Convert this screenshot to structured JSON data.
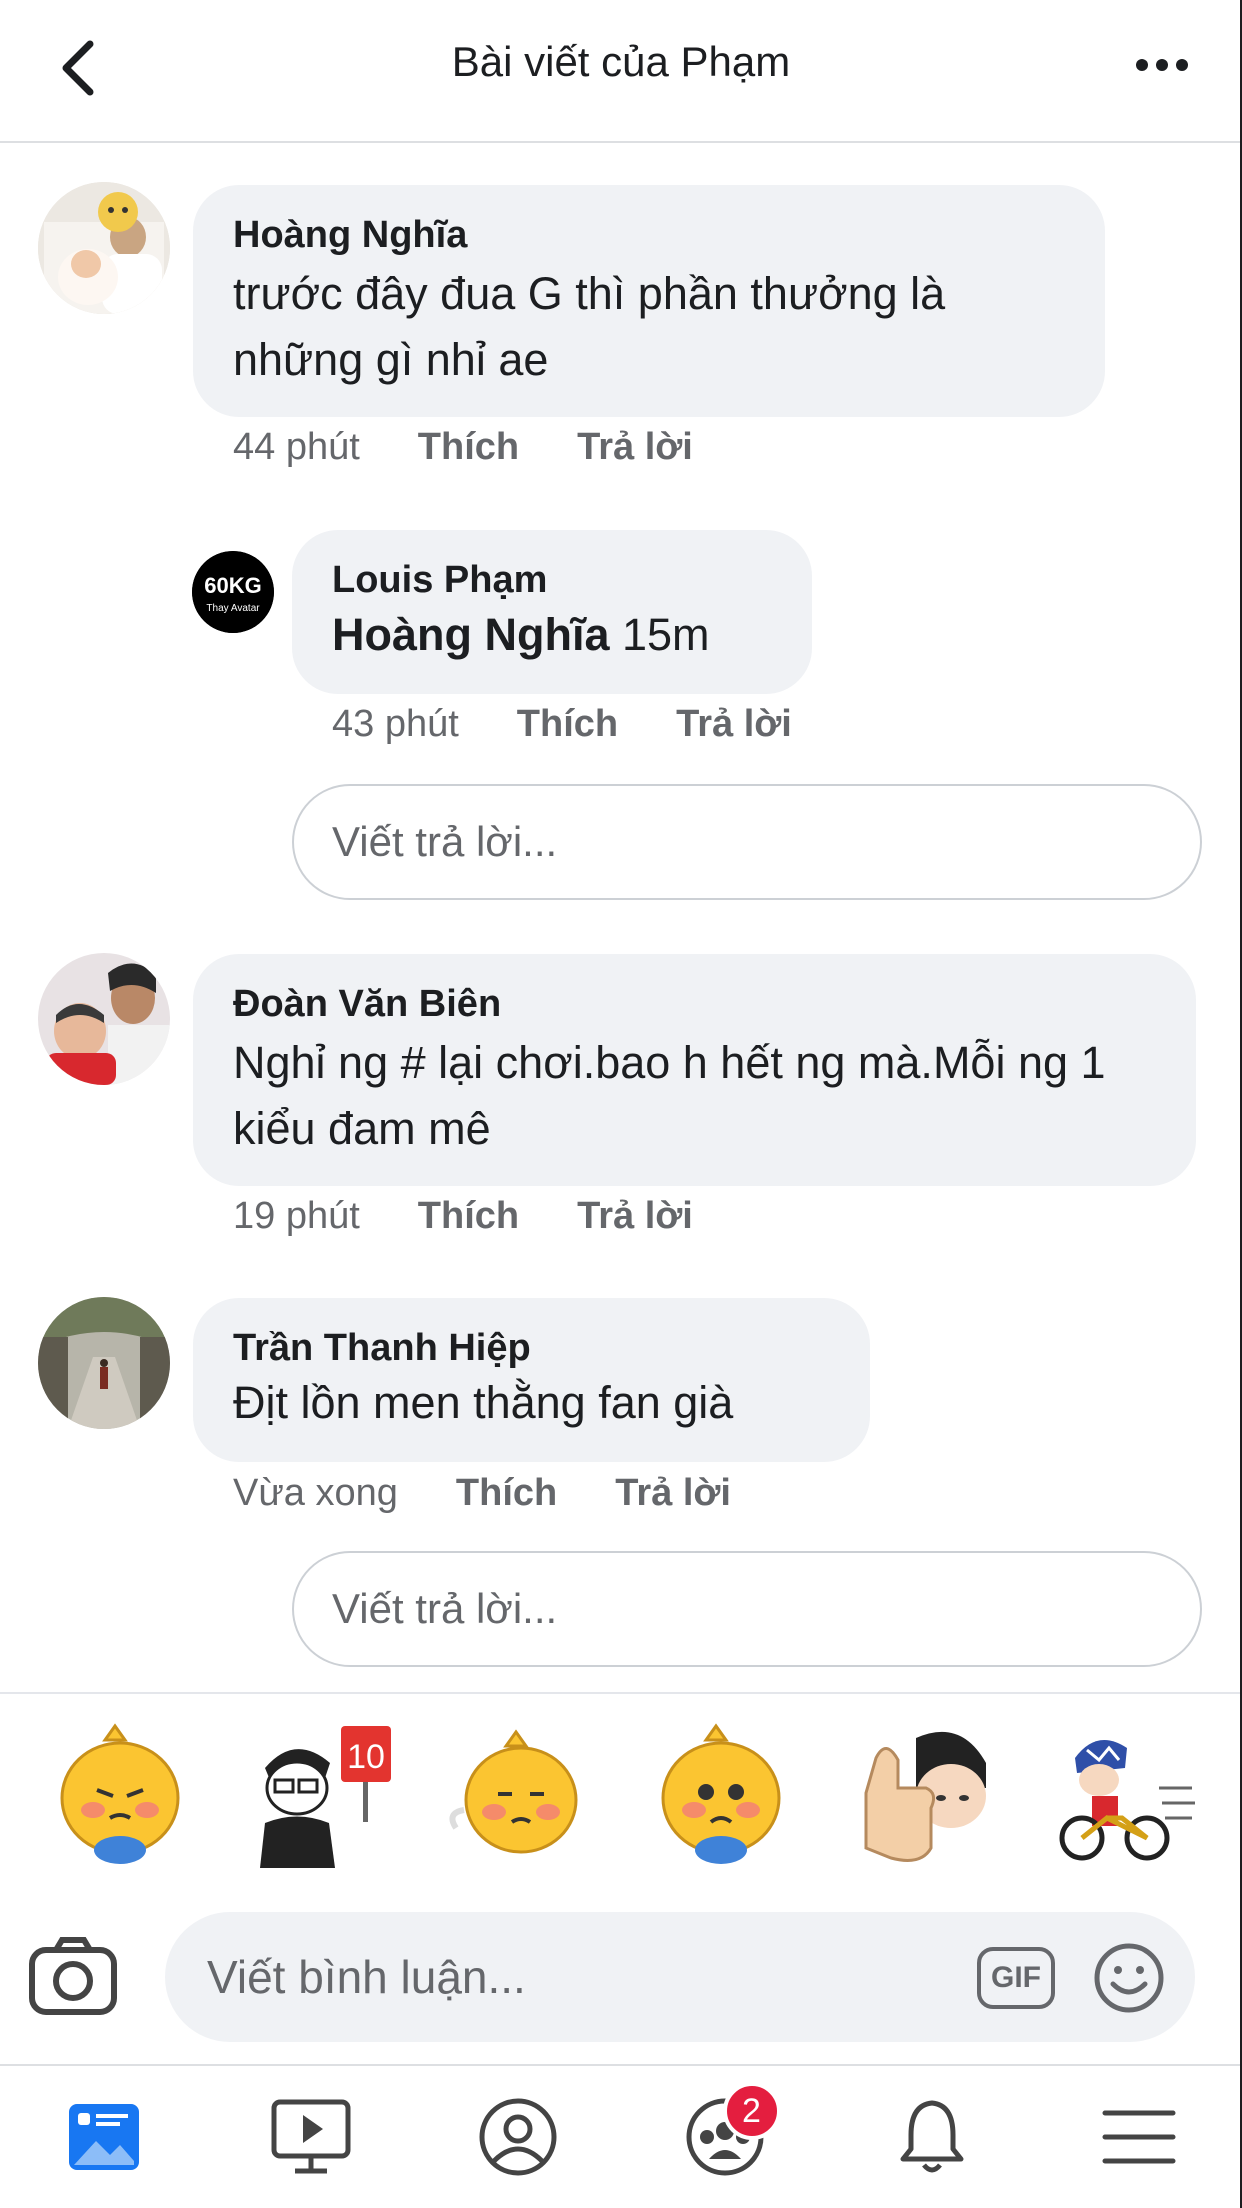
{
  "header": {
    "title": "Bài viết của Phạm"
  },
  "comments": [
    {
      "author": "Hoàng Nghĩa",
      "text": "trước đây đua G thì phần thưởng là những gì nhỉ ae",
      "time": "44 phút",
      "like_label": "Thích",
      "reply_label": "Trả lời"
    },
    {
      "author": "Louis Phạm",
      "mention": "Hoàng Nghĩa",
      "text": " 15m",
      "time": "43 phút",
      "like_label": "Thích",
      "reply_label": "Trả lời",
      "avatar_text": "60KG",
      "avatar_subtext": "Thay Avatar"
    },
    {
      "author": "Đoàn Văn Biên",
      "text": "Nghỉ ng # lại chơi.bao h hết ng mà.Mỗi ng 1 kiểu đam mê",
      "time": "19 phút",
      "like_label": "Thích",
      "reply_label": "Trả lời"
    },
    {
      "author": "Trần Thanh Hiệp",
      "text": "Địt lồn men thằng fan già",
      "time": "Vừa xong",
      "like_label": "Thích",
      "reply_label": "Trả lời"
    }
  ],
  "reply_input": {
    "placeholder": "Viết trả lời..."
  },
  "composer": {
    "placeholder": "Viết bình luận...",
    "gif_label": "GIF"
  },
  "stickers": [
    {
      "icon": "yellow-dragon-crying-sticker"
    },
    {
      "icon": "man-holding-10-sign-sticker"
    },
    {
      "icon": "yellow-dragon-pouting-sticker"
    },
    {
      "icon": "yellow-dragon-worried-sticker"
    },
    {
      "icon": "thumbs-up-girl-sticker"
    },
    {
      "icon": "cyclist-sticker"
    }
  ],
  "sticker_10_label": "10",
  "tabbar": {
    "groups_badge": "2",
    "icons": [
      "news-feed-icon",
      "watch-icon",
      "profile-icon",
      "groups-icon",
      "notifications-icon",
      "menu-icon"
    ],
    "active": "news-feed-icon",
    "active_color": "#1877f2"
  },
  "colors": {
    "bubble": "#f0f2f5",
    "meta_text": "#65676b",
    "badge": "#e41e3f"
  }
}
